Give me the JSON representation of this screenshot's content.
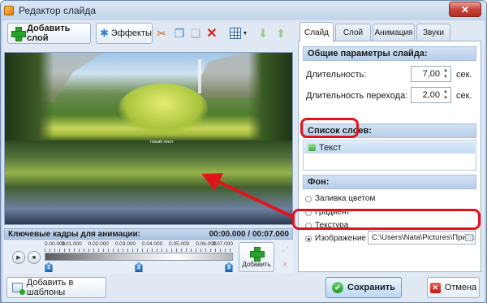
{
  "window": {
    "title": "Редактор слайда",
    "close_label": "✕"
  },
  "toolbar": {
    "add_layer_label": "Добавить слой",
    "effects_label": "Эффекты сл",
    "icons": [
      "scissors-icon",
      "copy-icon",
      "paste-icon",
      "delete-icon",
      "grid-icon",
      "down-arrow-icon",
      "up-arrow-icon"
    ]
  },
  "preview": {
    "caption": "тонкий текст"
  },
  "keyframes": {
    "header": "Ключевые кадры для анимации:",
    "time_range": "00:00.000 / 00:07.000",
    "ticks": [
      "0.00.000",
      "0.01.000",
      "0.02.000",
      "0.03.000",
      "0.04.000",
      "0.05.000",
      "0.06.000",
      "0.07.000"
    ],
    "markers": [
      "1",
      "2",
      "3"
    ],
    "add_label": "Добавить"
  },
  "bottom": {
    "templates_label": "Добавить в шаблоны",
    "save_label": "Сохранить",
    "cancel_label": "Отмена"
  },
  "tabs": [
    {
      "label": "Слайд",
      "active": true
    },
    {
      "label": "Слой",
      "active": false
    },
    {
      "label": "Анимация",
      "active": false
    },
    {
      "label": "Звуки",
      "active": false
    }
  ],
  "slide_params": {
    "title": "Общие параметры слайда:",
    "duration_label": "Длительность:",
    "duration_value": "7,00",
    "transition_label": "Длительность перехода:",
    "transition_value": "2,00",
    "unit": "сек."
  },
  "layers": {
    "title": "Список слоев:",
    "items": [
      "Текст"
    ]
  },
  "background": {
    "title": "Фон:",
    "options": [
      "Заливка цветом",
      "Градиент",
      "Текстура",
      "Изображение"
    ],
    "selected": "Изображение",
    "image_path": "C:\\Users\\Nata\\Pictures\\Прирс"
  },
  "colors": {
    "annotation": "#e1141c",
    "accent": "#2aa32a",
    "header_bg": "#c6d8ee"
  }
}
